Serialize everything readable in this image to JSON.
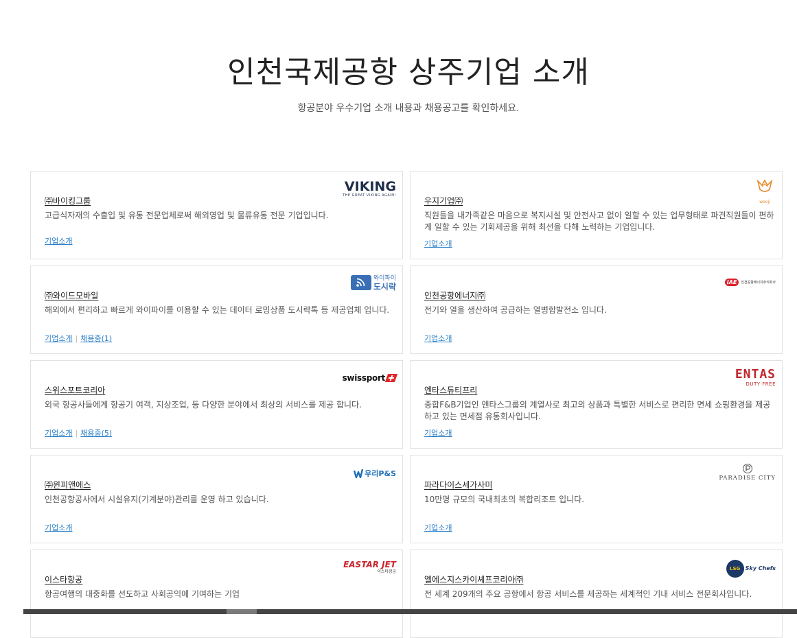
{
  "header": {
    "title": "인천국제공항 상주기업 소개",
    "subtitle": "항공분야 우수기업 소개 내용과 채용공고를 확인하세요."
  },
  "link_labels": {
    "intro": "기업소개",
    "separator": "|"
  },
  "companies": [
    {
      "name": "㈜바이킹그룹",
      "description": "고급식자재의 수출입 및 유통 전문업체로써 해외영업 및 물류유통 전문 기업입니다.",
      "recruit": "",
      "logo": {
        "main": "VIKING",
        "sub": "THE GREAT VIKING AGAIN!",
        "icon": "viking-logo-icon"
      }
    },
    {
      "name": "우지기업㈜",
      "description": "직원들을 내가족같은 마음으로 복지시설 및 안전사고 없이 일할 수 있는 업무형태로 파견직원들이 편하게 일할 수 있는 기회제공을 위해 최선을 다해 노력하는 기업입니다.",
      "recruit": "",
      "logo": {
        "main": "wooji",
        "icon": "wooji-logo-icon"
      }
    },
    {
      "name": "㈜와이드모바일",
      "description": "해외에서 편리하고 빠르게 와이파이를 이용할 수 있는 데이터 로밍상품 도시락톡 등 제공업체 입니다.",
      "recruit": "채용중(1)",
      "logo": {
        "main": "도시락",
        "sub": "와이파이",
        "icon": "wifi-icon"
      }
    },
    {
      "name": "인천공항에너지㈜",
      "description": "전기와 열을 생산하여 공급하는 열병합발전소 입니다.",
      "recruit": "",
      "logo": {
        "main": "IAE",
        "sub": "인천공항에너지주식회사",
        "icon": "iae-logo-icon"
      }
    },
    {
      "name": "스위스포트코리아",
      "description": "외국 항공사들에게 항공기 여객, 지상조업, 등 다양한 분야에서 최상의 서비스를 제공 합니다.",
      "recruit": "채용중(5)",
      "logo": {
        "main": "swissport",
        "icon": "swissport-plus-icon"
      }
    },
    {
      "name": "엔타스듀티프리",
      "description": "종합F&B기업인 엔타스그룹의 계열사로 최고의 상품과 특별한 서비스로 편리한 면세 쇼핑환경을 제공하고 있는 면세점 유통회사입니다.",
      "recruit": "",
      "logo": {
        "main": "ENTAS",
        "sub": "DUTY FREE",
        "icon": "entas-logo-icon"
      }
    },
    {
      "name": "㈜윈피앤에스",
      "description": "인천공항공사에서 시설유지(기계분야)관리를 운영 하고 있습니다.",
      "recruit": "",
      "logo": {
        "main": "우리P&S",
        "icon": "woori-logo-icon"
      }
    },
    {
      "name": "파라다이스세가사미",
      "description": "10만명 규모의 국내최초의 복합리조트 입니다.",
      "recruit": "",
      "logo": {
        "main": "PARADISE CITY",
        "icon": "paradise-logo-icon"
      }
    },
    {
      "name": "이스타항공",
      "description": "항공여행의 대중화를 선도하고 사회공익에 기여하는 기업",
      "recruit": "",
      "logo": {
        "main": "EASTAR JET",
        "sub": "이스타항공",
        "icon": "eastar-logo-icon"
      }
    },
    {
      "name": "엘에스지스카이셰프코리아㈜",
      "description": "전 세계 209개의 주요 공항에서 항공 서비스를 제공하는 세계적인 기내 서비스 전문회사입니다.",
      "recruit": "",
      "logo": {
        "main": "Sky Chefs",
        "sub": "LSG",
        "icon": "lsg-logo-icon"
      }
    }
  ]
}
